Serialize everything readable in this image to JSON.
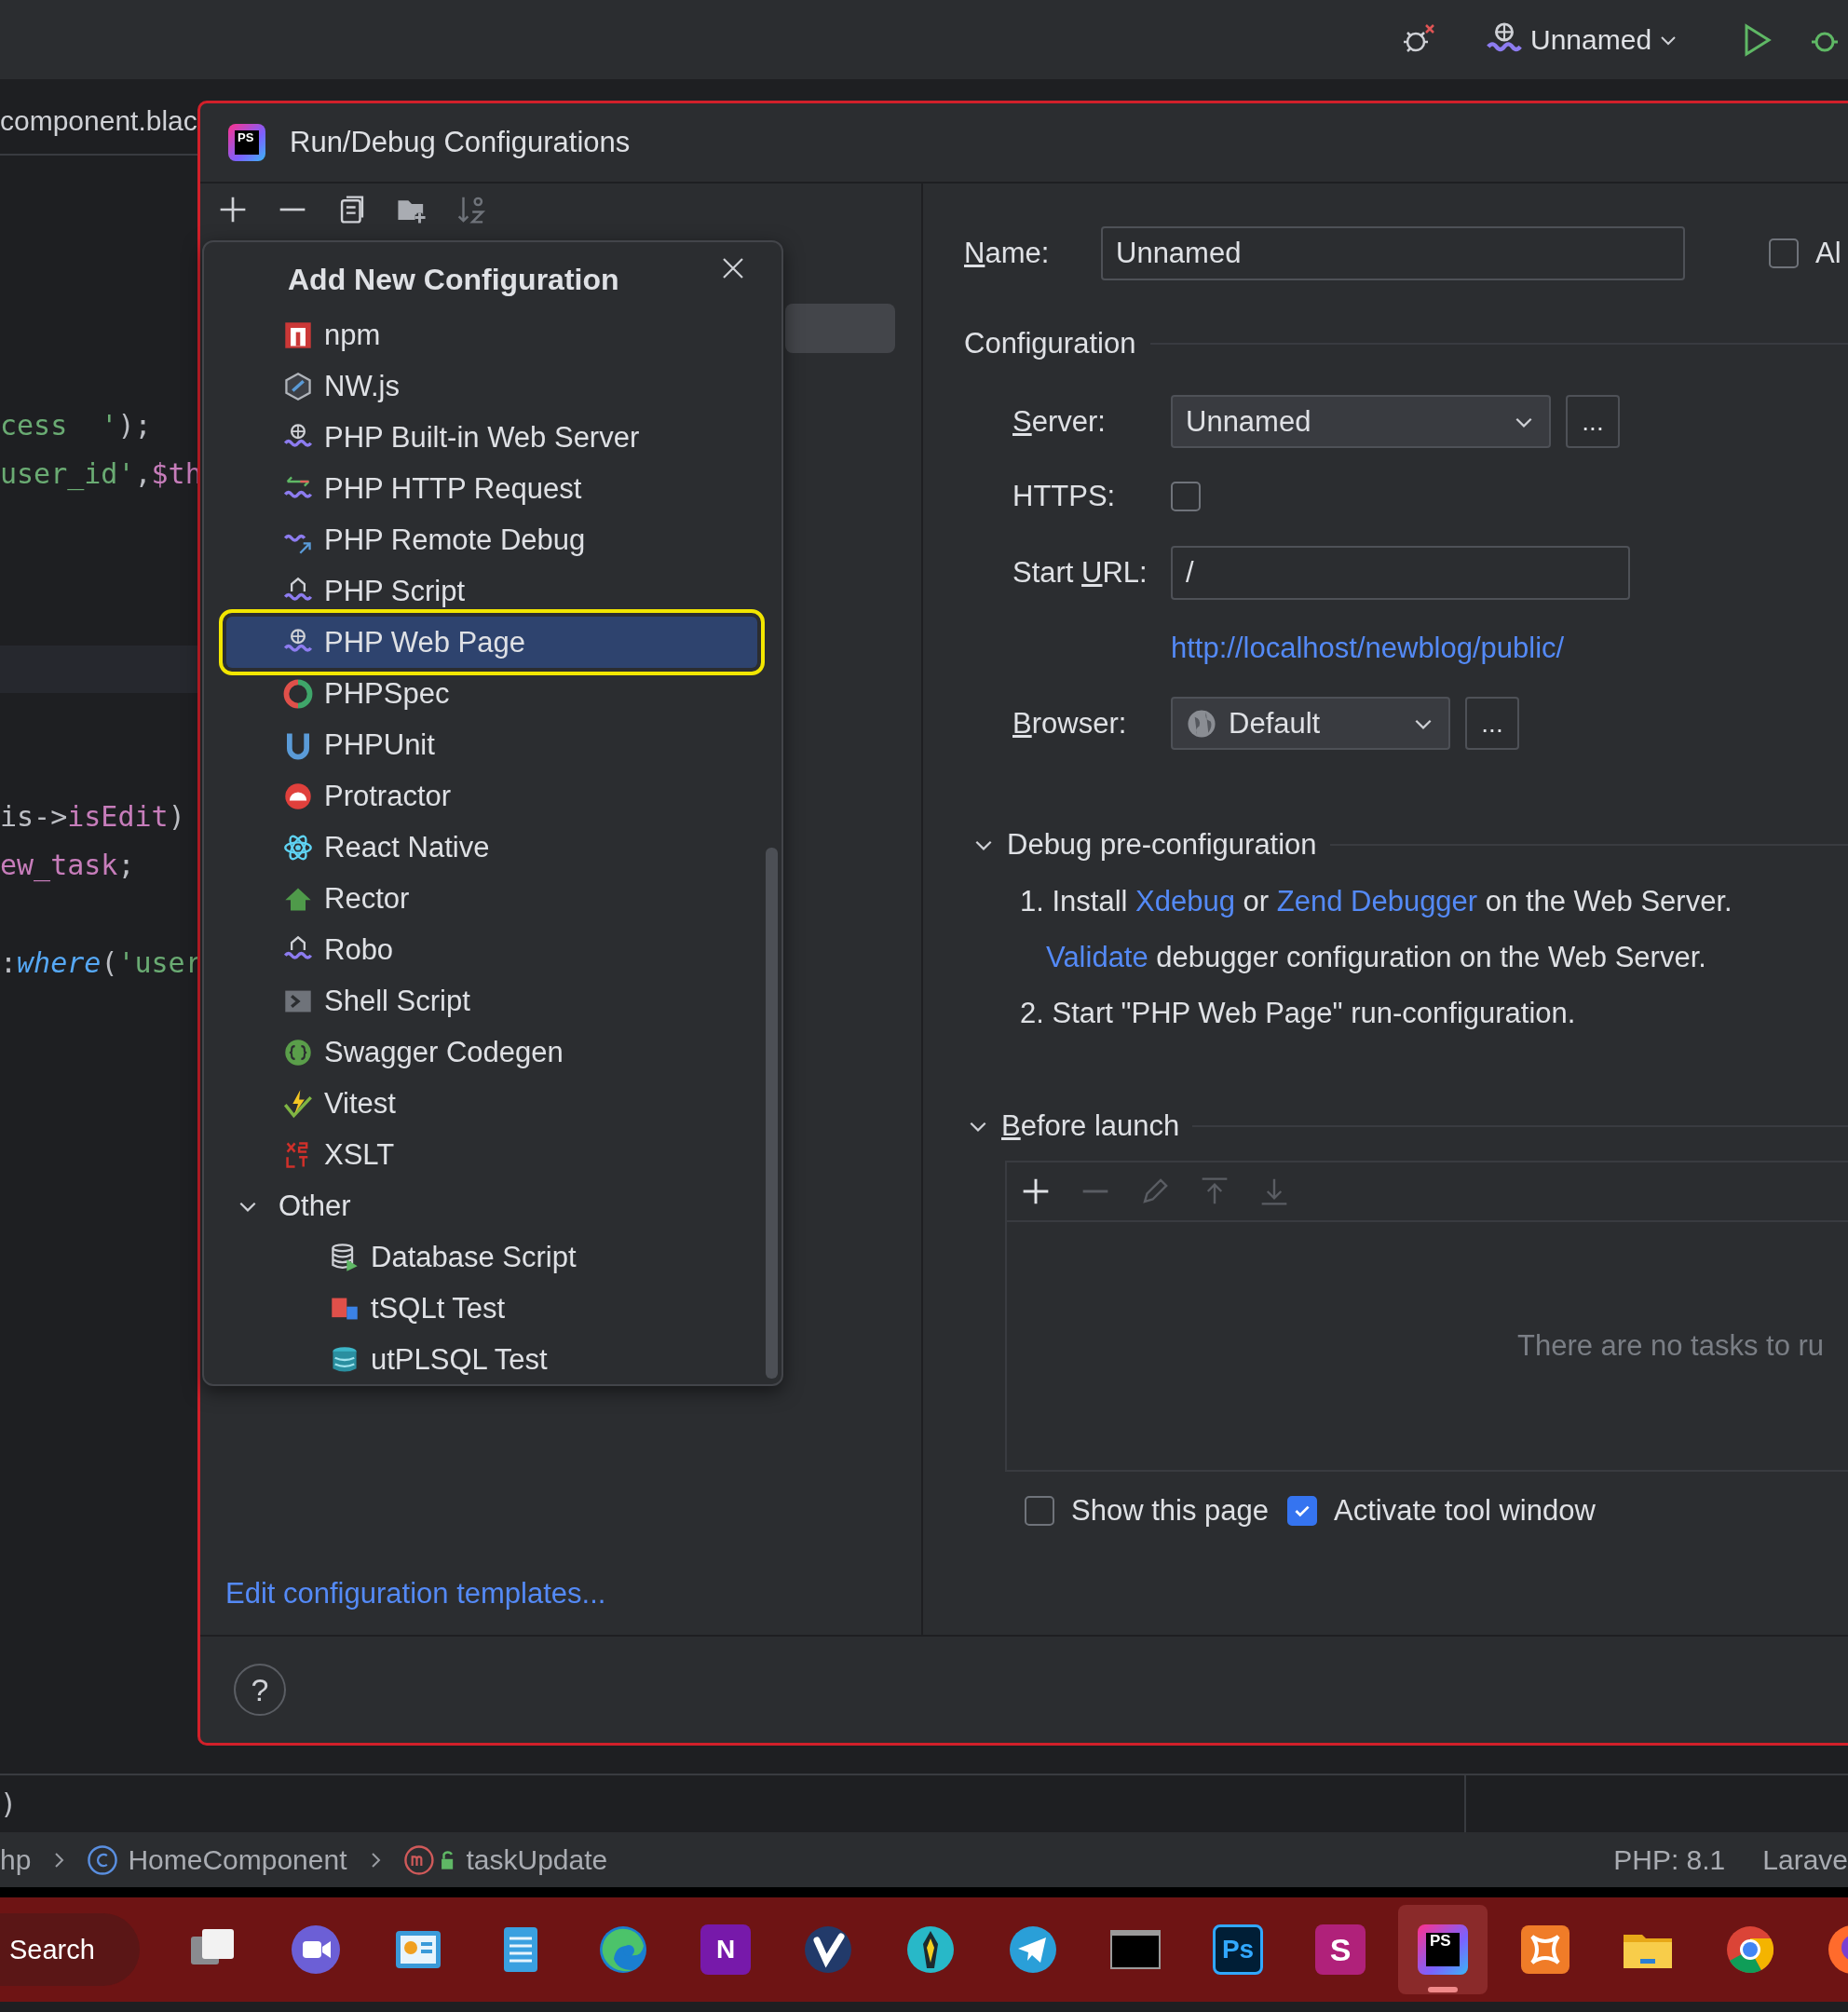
{
  "top_bar": {
    "config_name": "Unnamed"
  },
  "editor": {
    "tab": "component.blac",
    "code_lines": [
      {
        "tokens": [
          {
            "text": "cess  '",
            "kind": "string"
          },
          {
            "text": ");",
            "kind": "plain"
          }
        ]
      },
      {
        "tokens": [
          {
            "text": "user_id'",
            "kind": "string"
          },
          {
            "text": ",",
            "kind": "plain"
          },
          {
            "text": "$th",
            "kind": "var"
          }
        ]
      },
      {
        "tokens": [
          {
            "text": "is->",
            "kind": "plain"
          },
          {
            "text": "isEdit",
            "kind": "var"
          },
          {
            "text": ")",
            "kind": "plain"
          }
        ]
      },
      {
        "tokens": [
          {
            "text": "ew_task",
            "kind": "var"
          },
          {
            "text": ";",
            "kind": "plain"
          }
        ]
      },
      {
        "tokens": [
          {
            "text": ":",
            "kind": "plain"
          },
          {
            "text": "where",
            "kind": "func"
          },
          {
            "text": "(",
            "kind": "plain"
          },
          {
            "text": "'user",
            "kind": "string"
          }
        ]
      }
    ],
    "bottom_line": ")"
  },
  "dialog": {
    "logo_text": "PS",
    "title": "Run/Debug Configurations",
    "popup": {
      "title": "Add New Configuration",
      "items": [
        {
          "label": "npm",
          "kind": "npm",
          "selected": false
        },
        {
          "label": "NW.js",
          "kind": "nwjs",
          "selected": false
        },
        {
          "label": "PHP Built-in Web Server",
          "kind": "php-globe",
          "selected": false
        },
        {
          "label": "PHP HTTP Request",
          "kind": "php-arrows",
          "selected": false
        },
        {
          "label": "PHP Remote Debug",
          "kind": "php-remote",
          "selected": false
        },
        {
          "label": "PHP Script",
          "kind": "php-script",
          "selected": false
        },
        {
          "label": "PHP Web Page",
          "kind": "php-globe",
          "selected": true
        },
        {
          "label": "PHPSpec",
          "kind": "phpspec",
          "selected": false
        },
        {
          "label": "PHPUnit",
          "kind": "phpunit",
          "selected": false
        },
        {
          "label": "Protractor",
          "kind": "protractor",
          "selected": false
        },
        {
          "label": "React Native",
          "kind": "react",
          "selected": false
        },
        {
          "label": "Rector",
          "kind": "rector",
          "selected": false
        },
        {
          "label": "Robo",
          "kind": "php-script",
          "selected": false
        },
        {
          "label": "Shell Script",
          "kind": "shell",
          "selected": false
        },
        {
          "label": "Swagger Codegen",
          "kind": "swagger",
          "selected": false
        },
        {
          "label": "Vitest",
          "kind": "vitest",
          "selected": false
        },
        {
          "label": "XSLT",
          "kind": "xslt",
          "selected": false
        }
      ],
      "group": {
        "label": "Other",
        "expanded": true,
        "children": [
          {
            "label": "Database Script",
            "kind": "database",
            "selected": false
          },
          {
            "label": "tSQLt Test",
            "kind": "tsqlt",
            "selected": false
          },
          {
            "label": "utPLSQL Test",
            "kind": "utplsql",
            "selected": false
          }
        ]
      }
    },
    "templates_link": "Edit configuration templates...",
    "help": "?",
    "form": {
      "name": {
        "label": "Name:",
        "value": "Unnamed"
      },
      "allow": {
        "label": "Al",
        "checked": false
      },
      "configuration_title": "Configuration",
      "server": {
        "label": "Server:",
        "value": "Unnamed",
        "more": "..."
      },
      "https": {
        "label": "HTTPS:",
        "checked": false
      },
      "start_url": {
        "label": "Start URL:",
        "value": "/"
      },
      "url_link": "http://localhost/newblog/public/",
      "browser": {
        "label": "Browser:",
        "value": "Default",
        "more": "..."
      },
      "debug": {
        "title": "Debug pre-configuration",
        "expanded": true,
        "lines": [
          {
            "parts": [
              {
                "text": "1. Install ",
                "kind": "text"
              },
              {
                "text": "Xdebug",
                "kind": "link"
              },
              {
                "text": " or ",
                "kind": "text"
              },
              {
                "text": "Zend Debugger",
                "kind": "link"
              },
              {
                "text": " on the Web Server.",
                "kind": "text"
              }
            ]
          },
          {
            "parts": [
              {
                "text": "Validate",
                "kind": "link"
              },
              {
                "text": " debugger configuration on the Web Server.",
                "kind": "text"
              }
            ]
          },
          {
            "parts": [
              {
                "text": "2. Start \"PHP Web Page\" run-configuration.",
                "kind": "text"
              }
            ]
          }
        ]
      },
      "before_launch": {
        "title": "Before launch",
        "expanded": true,
        "tools": [
          {
            "kind": "add",
            "disabled": false
          },
          {
            "kind": "remove",
            "disabled": true
          },
          {
            "kind": "edit",
            "disabled": true
          },
          {
            "kind": "up",
            "disabled": true
          },
          {
            "kind": "down",
            "disabled": true
          }
        ],
        "empty_text": "There are no tasks to ru"
      },
      "options": [
        {
          "label": "Show this page",
          "checked": false
        },
        {
          "label": "Activate tool window",
          "checked": true
        }
      ]
    }
  },
  "status_bar": {
    "crumbs": [
      {
        "label": "hp",
        "kind": "file"
      },
      {
        "label": "HomeComponent",
        "kind": "class"
      },
      {
        "label": "taskUpdate",
        "kind": "method"
      }
    ],
    "right": [
      "PHP: 8.1",
      "Larave"
    ]
  },
  "taskbar": {
    "search": "Search",
    "apps": [
      {
        "kind": "taskview",
        "selected": false
      },
      {
        "kind": "video",
        "selected": false
      },
      {
        "kind": "board",
        "selected": false
      },
      {
        "kind": "notepad",
        "selected": false
      },
      {
        "kind": "edge",
        "selected": false
      },
      {
        "kind": "onenote",
        "label": "N",
        "selected": false
      },
      {
        "kind": "vlogo",
        "selected": false
      },
      {
        "kind": "lamp",
        "selected": false
      },
      {
        "kind": "telegram",
        "selected": false
      },
      {
        "kind": "terminal",
        "selected": false
      },
      {
        "kind": "photoshop",
        "label": "Ps",
        "selected": false
      },
      {
        "kind": "sublime",
        "label": "S",
        "selected": false
      },
      {
        "kind": "phpstorm",
        "label": "PS",
        "selected": true
      },
      {
        "kind": "xampp",
        "selected": false
      },
      {
        "kind": "folder",
        "selected": false
      },
      {
        "kind": "chrome",
        "selected": false
      },
      {
        "kind": "firefox",
        "selected": false
      }
    ]
  }
}
